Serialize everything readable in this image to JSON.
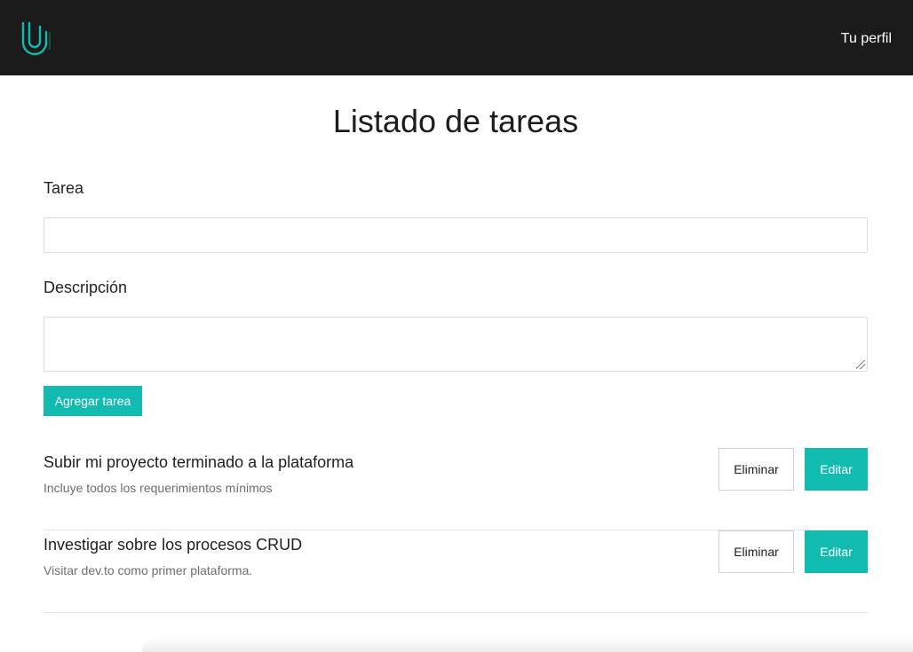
{
  "navbar": {
    "logo_icon": "u-camp-logo-icon",
    "profile_link": "Tu perfil",
    "bg_color": "#1b1b1b",
    "accent_color": "#12bbb0"
  },
  "page": {
    "title": "Listado de tareas"
  },
  "form": {
    "task_label": "Tarea",
    "task_value": "",
    "description_label": "Descripción",
    "description_value": "",
    "add_button": "Agregar tarea"
  },
  "tasks": [
    {
      "title": "Subir mi proyecto terminado a la plataforma",
      "description": "Incluye todos los requerimientos mínimos",
      "delete_label": "Eliminar",
      "edit_label": "Editar"
    },
    {
      "title": "Investigar sobre los procesos CRUD",
      "description": "Visitar dev.to como primer plataforma.",
      "delete_label": "Eliminar",
      "edit_label": "Editar"
    }
  ]
}
